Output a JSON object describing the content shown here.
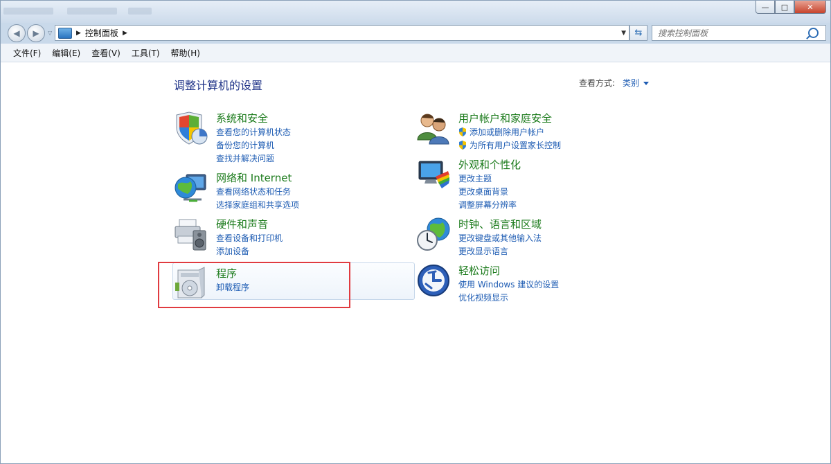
{
  "window": {
    "blurred_title_segments": [
      "",
      "",
      ""
    ],
    "buttons": {
      "minimize": "—",
      "maximize": "□",
      "close": "✕"
    }
  },
  "nav": {
    "back_icon": "back-arrow-icon",
    "forward_icon": "forward-arrow-icon",
    "breadcrumb": [
      "控制面板"
    ],
    "search_placeholder": "搜索控制面板"
  },
  "menu": [
    "文件(F)",
    "编辑(E)",
    "查看(V)",
    "工具(T)",
    "帮助(H)"
  ],
  "main": {
    "title": "调整计算机的设置",
    "view_label": "查看方式:",
    "view_value": "类别"
  },
  "categories": [
    {
      "id": "system-security",
      "icon": "shield-pie-icon",
      "title": "系统和安全",
      "links": [
        "查看您的计算机状态",
        "备份您的计算机",
        "查找并解决问题"
      ],
      "shield": [
        false,
        false,
        false
      ]
    },
    {
      "id": "network-internet",
      "icon": "globe-network-icon",
      "title": "网络和 Internet",
      "links": [
        "查看网络状态和任务",
        "选择家庭组和共享选项"
      ],
      "shield": [
        false,
        false
      ]
    },
    {
      "id": "hardware-sound",
      "icon": "printer-speaker-icon",
      "title": "硬件和声音",
      "links": [
        "查看设备和打印机",
        "添加设备"
      ],
      "shield": [
        false,
        false
      ]
    },
    {
      "id": "programs",
      "icon": "program-box-icon",
      "title": "程序",
      "links": [
        "卸载程序"
      ],
      "shield": [
        false
      ]
    },
    {
      "id": "user-accounts",
      "icon": "users-icon",
      "title": "用户帐户和家庭安全",
      "links": [
        "添加或删除用户帐户",
        "为所有用户设置家长控制"
      ],
      "shield": [
        true,
        true
      ]
    },
    {
      "id": "appearance",
      "icon": "monitor-palette-icon",
      "title": "外观和个性化",
      "links": [
        "更改主题",
        "更改桌面背景",
        "调整屏幕分辨率"
      ],
      "shield": [
        false,
        false,
        false
      ]
    },
    {
      "id": "clock-region",
      "icon": "clock-globe-icon",
      "title": "时钟、语言和区域",
      "links": [
        "更改键盘或其他输入法",
        "更改显示语言"
      ],
      "shield": [
        false,
        false
      ]
    },
    {
      "id": "ease-access",
      "icon": "ease-of-access-icon",
      "title": "轻松访问",
      "links": [
        "使用 Windows 建议的设置",
        "优化视频显示"
      ],
      "shield": [
        false,
        false
      ]
    }
  ],
  "colors": {
    "category_title": "#1a7a1a",
    "link": "#1e5cb3",
    "heading": "#1e3287",
    "highlight": "#e03b40"
  }
}
